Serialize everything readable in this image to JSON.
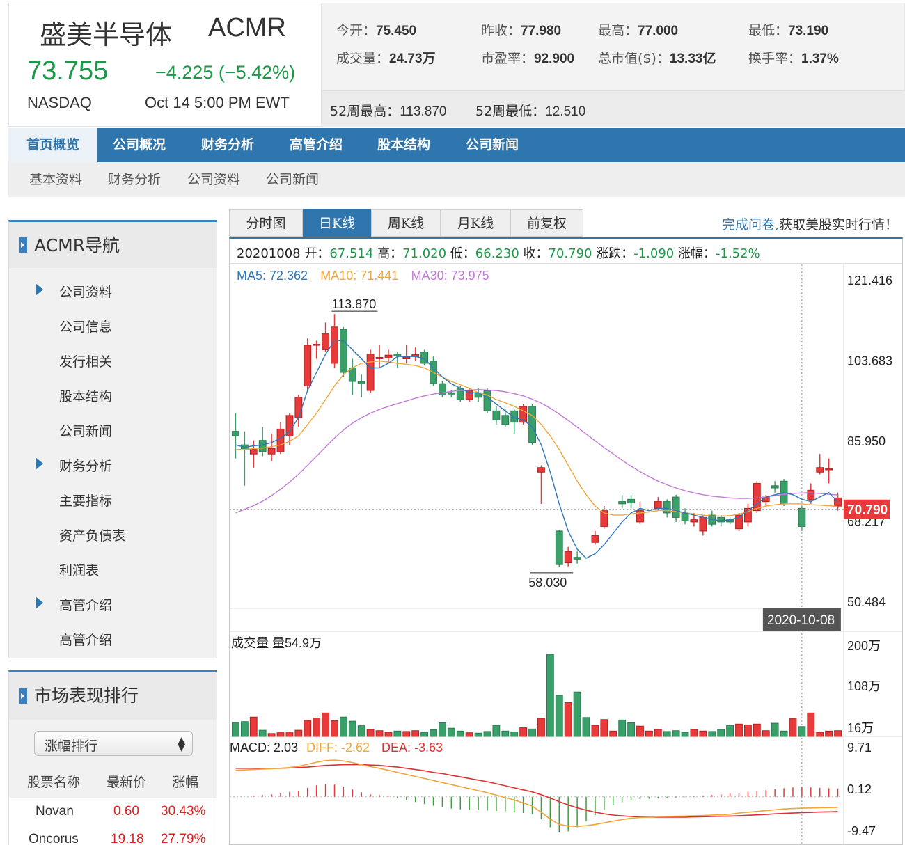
{
  "quote": {
    "name": "盛美半导体",
    "ticker": "ACMR",
    "price": "73.755",
    "change": "−4.225 (−5.42%)",
    "exchange": "NASDAQ",
    "time": "Oct 14 5:00 PM EWT",
    "stats_row1": [
      {
        "label": "今开：",
        "value": "75.450"
      },
      {
        "label": "昨收：",
        "value": "77.980"
      },
      {
        "label": "最高：",
        "value": "77.000"
      },
      {
        "label": "最低：",
        "value": "73.190"
      }
    ],
    "stats_row2": [
      {
        "label": "成交量：",
        "value": "24.73万"
      },
      {
        "label": "市盈率：",
        "value": "92.900"
      },
      {
        "label": "总市值($)：",
        "value": "13.33亿"
      },
      {
        "label": "换手率：",
        "value": "1.37%"
      }
    ],
    "week52_high_label": "52周最高：",
    "week52_high": "113.870",
    "week52_low_label": "52周最低：",
    "week52_low": "12.510",
    "down_color": "#1a9a47"
  },
  "nav": {
    "tabs": [
      "首页概览",
      "公司概况",
      "财务分析",
      "高管介绍",
      "股本结构",
      "公司新闻"
    ],
    "subtabs": [
      "基本资料",
      "财务分析",
      "公司资料",
      "公司新闻"
    ]
  },
  "sidebar": {
    "title": "ACMR导航",
    "items": [
      {
        "label": "公司资料",
        "section": true
      },
      {
        "label": "公司信息",
        "section": false
      },
      {
        "label": "发行相关",
        "section": false
      },
      {
        "label": "股本结构",
        "section": false
      },
      {
        "label": "公司新闻",
        "section": false
      },
      {
        "label": "财务分析",
        "section": true
      },
      {
        "label": "主要指标",
        "section": false
      },
      {
        "label": "资产负债表",
        "section": false
      },
      {
        "label": "利润表",
        "section": false
      },
      {
        "label": "高管介绍",
        "section": true
      },
      {
        "label": "高管介绍",
        "section": false
      }
    ]
  },
  "ranking": {
    "title": "市场表现排行",
    "select_value": "涨幅排行",
    "headers": [
      "股票名称",
      "最新价",
      "涨幅"
    ],
    "rows": [
      {
        "name": "Novan",
        "price": "0.60",
        "change": "30.43%"
      },
      {
        "name": "Oncorus",
        "price": "19.18",
        "change": "27.79%"
      }
    ]
  },
  "chart_tabs": {
    "tabs": [
      "分时图",
      "日K线",
      "周K线",
      "月K线",
      "前复权"
    ],
    "active": "日K线",
    "promo_link": "完成问卷,",
    "promo_text": "获取美股实时行情！"
  },
  "chart_info": {
    "date": "20201008",
    "fields": [
      {
        "label": " 开：",
        "value": "67.514"
      },
      {
        "label": " 高：",
        "value": "71.020"
      },
      {
        "label": " 低：",
        "value": "66.230"
      },
      {
        "label": " 收：",
        "value": "70.790"
      },
      {
        "label": " 涨跌：",
        "value": "-1.090"
      },
      {
        "label": " 涨幅：",
        "value": "-1.52%"
      }
    ],
    "ma": [
      {
        "label": "MA5: 72.362",
        "color": "#2f77b8"
      },
      {
        "label": "MA10: 71.441",
        "color": "#f0a63a"
      },
      {
        "label": "MA30: 73.975",
        "color": "#c27ad6"
      }
    ]
  },
  "chart_data": {
    "type": "candlestick",
    "title": "",
    "y_ticks": [
      "121.416",
      "103.683",
      "85.950",
      "68.217",
      "50.484"
    ],
    "ylim": [
      50.484,
      121.416
    ],
    "current_price": "70.790",
    "max_label": "113.870",
    "min_label": "58.030",
    "crosshair_date": "2020-10-08",
    "up_color": "#e83a3a",
    "down_color": "#3aa06a",
    "candles": [
      {
        "o": 88.0,
        "h": 92.0,
        "l": 82.0,
        "c": 87.0
      },
      {
        "o": 85.0,
        "h": 88.0,
        "l": 76.0,
        "c": 84.0
      },
      {
        "o": 83.0,
        "h": 86.0,
        "l": 80.0,
        "c": 84.0
      },
      {
        "o": 86.0,
        "h": 89.0,
        "l": 82.5,
        "c": 83.5
      },
      {
        "o": 83.0,
        "h": 87.5,
        "l": 81.5,
        "c": 84.2
      },
      {
        "o": 83.5,
        "h": 90.0,
        "l": 83.0,
        "c": 88.5
      },
      {
        "o": 87.0,
        "h": 92.0,
        "l": 85.0,
        "c": 91.5
      },
      {
        "o": 91.0,
        "h": 96.0,
        "l": 89.0,
        "c": 95.5
      },
      {
        "o": 98.0,
        "h": 108.5,
        "l": 97.0,
        "c": 107.0
      },
      {
        "o": 107.0,
        "h": 108.0,
        "l": 104.0,
        "c": 107.2
      },
      {
        "o": 106.0,
        "h": 112.0,
        "l": 105.5,
        "c": 109.5
      },
      {
        "o": 103.0,
        "h": 113.87,
        "l": 102.0,
        "c": 111.0
      },
      {
        "o": 110.5,
        "h": 111.0,
        "l": 100.0,
        "c": 101.0
      },
      {
        "o": 102.0,
        "h": 104.0,
        "l": 96.0,
        "c": 99.0
      },
      {
        "o": 99.0,
        "h": 100.5,
        "l": 95.5,
        "c": 98.5
      },
      {
        "o": 97.0,
        "h": 106.0,
        "l": 96.5,
        "c": 105.0
      },
      {
        "o": 104.0,
        "h": 107.0,
        "l": 102.0,
        "c": 104.3
      },
      {
        "o": 104.2,
        "h": 106.0,
        "l": 103.0,
        "c": 104.8
      },
      {
        "o": 105.0,
        "h": 105.5,
        "l": 102.0,
        "c": 104.6
      },
      {
        "o": 104.0,
        "h": 107.0,
        "l": 103.0,
        "c": 104.4
      },
      {
        "o": 104.5,
        "h": 106.5,
        "l": 103.5,
        "c": 104.9
      },
      {
        "o": 105.5,
        "h": 106.0,
        "l": 102.5,
        "c": 103.0
      },
      {
        "o": 103.5,
        "h": 104.5,
        "l": 98.0,
        "c": 98.5
      },
      {
        "o": 98.5,
        "h": 99.0,
        "l": 95.5,
        "c": 96.0
      },
      {
        "o": 96.5,
        "h": 97.0,
        "l": 95.5,
        "c": 96.2
      },
      {
        "o": 97.5,
        "h": 98.0,
        "l": 94.5,
        "c": 95.0
      },
      {
        "o": 95.0,
        "h": 97.5,
        "l": 94.5,
        "c": 97.0
      },
      {
        "o": 96.5,
        "h": 97.5,
        "l": 94.5,
        "c": 95.5
      },
      {
        "o": 97.0,
        "h": 97.5,
        "l": 92.0,
        "c": 92.5
      },
      {
        "o": 92.5,
        "h": 93.5,
        "l": 89.5,
        "c": 90.5
      },
      {
        "o": 91.5,
        "h": 93.0,
        "l": 89.0,
        "c": 89.5
      },
      {
        "o": 92.5,
        "h": 93.0,
        "l": 87.5,
        "c": 90.0
      },
      {
        "o": 90.0,
        "h": 94.0,
        "l": 89.5,
        "c": 93.5
      },
      {
        "o": 93.5,
        "h": 94.0,
        "l": 85.0,
        "c": 85.5
      },
      {
        "o": 79.0,
        "h": 80.5,
        "l": 72.0,
        "c": 80.0
      },
      {
        "o": 1,
        "h": 1,
        "l": 1,
        "c": 1,
        "skip": true
      },
      {
        "o": 66.0,
        "h": 66.2,
        "l": 58.03,
        "c": 58.6
      },
      {
        "o": 59.0,
        "h": 62.5,
        "l": 58.2,
        "c": 61.5
      },
      {
        "o": 60.2,
        "h": 61.5,
        "l": 58.8,
        "c": 59.8
      },
      {
        "o": 1,
        "h": 1,
        "l": 1,
        "c": 1,
        "skip": true
      },
      {
        "o": 63.5,
        "h": 66.0,
        "l": 63.0,
        "c": 65.0
      },
      {
        "o": 67.0,
        "h": 71.5,
        "l": 66.5,
        "c": 70.5
      },
      {
        "o": 1,
        "h": 1,
        "l": 1,
        "c": 1,
        "skip": true
      },
      {
        "o": 72.5,
        "h": 74.0,
        "l": 71.0,
        "c": 72.0
      },
      {
        "o": 73.0,
        "h": 74.0,
        "l": 71.0,
        "c": 72.2
      },
      {
        "o": 68.0,
        "h": 72.5,
        "l": 67.5,
        "c": 70.5
      },
      {
        "o": 1,
        "h": 1,
        "l": 1,
        "c": 1,
        "skip": true
      },
      {
        "o": 71.0,
        "h": 73.5,
        "l": 70.5,
        "c": 72.5
      },
      {
        "o": 72.5,
        "h": 73.0,
        "l": 69.0,
        "c": 70.0
      },
      {
        "o": 73.5,
        "h": 74.0,
        "l": 68.0,
        "c": 69.0
      },
      {
        "o": 70.0,
        "h": 71.0,
        "l": 67.5,
        "c": 68.2
      },
      {
        "o": 68.0,
        "h": 70.0,
        "l": 67.0,
        "c": 68.5
      },
      {
        "o": 66.0,
        "h": 69.5,
        "l": 65.0,
        "c": 69.0
      },
      {
        "o": 69.5,
        "h": 70.5,
        "l": 67.0,
        "c": 67.5
      },
      {
        "o": 69.0,
        "h": 69.5,
        "l": 67.0,
        "c": 68.0
      },
      {
        "o": 68.5,
        "h": 69.0,
        "l": 67.5,
        "c": 68.0
      },
      {
        "o": 66.5,
        "h": 70.0,
        "l": 66.0,
        "c": 69.5
      },
      {
        "o": 68.0,
        "h": 72.0,
        "l": 67.0,
        "c": 71.0
      },
      {
        "o": 70.5,
        "h": 77.0,
        "l": 70.0,
        "c": 76.5
      },
      {
        "o": 72.5,
        "h": 74.0,
        "l": 71.5,
        "c": 73.5
      },
      {
        "o": 76.0,
        "h": 77.0,
        "l": 74.5,
        "c": 75.5
      },
      {
        "o": 77.0,
        "h": 77.5,
        "l": 71.5,
        "c": 72.0
      },
      {
        "o": 1,
        "h": 1,
        "l": 1,
        "c": 1,
        "skip": true
      },
      {
        "o": 71.0,
        "h": 71.5,
        "l": 66.0,
        "c": 67.0
      },
      {
        "o": 73.0,
        "h": 76.5,
        "l": 72.0,
        "c": 75.0
      },
      {
        "o": 79.0,
        "h": 83.0,
        "l": 78.5,
        "c": 80.0
      },
      {
        "o": 79.5,
        "h": 82.0,
        "l": 76.5,
        "c": 79.8
      },
      {
        "o": 71.5,
        "h": 74.5,
        "l": 70.5,
        "c": 73.3
      }
    ],
    "ma5": [
      85,
      84.5,
      84.8,
      85,
      85.5,
      86.5,
      88,
      91,
      97,
      101,
      105,
      108,
      108,
      106,
      104,
      102,
      102,
      103,
      104.5,
      104.5,
      104.5,
      104,
      102,
      100,
      98.5,
      97.5,
      96.5,
      96.5,
      95.5,
      94,
      92.5,
      91,
      90.5,
      89,
      85,
      79,
      72,
      66,
      62,
      60,
      61,
      63,
      65.5,
      68,
      70,
      71,
      70.5,
      71,
      71,
      70.5,
      70,
      69.5,
      69,
      68.5,
      68.3,
      68.5,
      69,
      70.5,
      72,
      73.5,
      74,
      74.5,
      74,
      73,
      72.5,
      73.5,
      74.5,
      72.4
    ],
    "ma10": [
      84,
      84,
      84.2,
      84.3,
      84.6,
      85,
      85.8,
      87,
      89.5,
      92,
      95,
      98,
      100.5,
      102,
      103,
      103.3,
      103.5,
      103.3,
      103,
      102.8,
      102.5,
      102,
      101,
      100,
      99,
      98.3,
      97.5,
      96.5,
      96,
      95,
      94.3,
      93.5,
      92.5,
      91.5,
      89.5,
      87,
      84,
      80.5,
      77,
      74,
      71.5,
      70,
      69.5,
      69.5,
      69.8,
      70,
      70.2,
      70.5,
      70.5,
      70.3,
      70,
      69.8,
      69.5,
      69.3,
      69.3,
      69.4,
      69.7,
      70.3,
      71,
      71.5,
      71.8,
      72,
      72,
      72,
      71.8,
      71.7,
      71.6,
      71.4
    ],
    "ma30": [
      70,
      70.8,
      71.6,
      72.6,
      73.8,
      75.2,
      76.8,
      78.5,
      80.5,
      82.5,
      84.5,
      86.5,
      88.3,
      89.8,
      91,
      92,
      92.8,
      93.5,
      94.1,
      94.7,
      95.3,
      95.8,
      96.2,
      96.5,
      96.8,
      97,
      97.1,
      97.2,
      97.1,
      97,
      96.7,
      96.3,
      95.8,
      95.1,
      94.2,
      93.1,
      91.8,
      90.4,
      88.9,
      87.4,
      85.9,
      84.4,
      83,
      81.6,
      80.3,
      79.1,
      78,
      77,
      76.2,
      75.5,
      74.9,
      74.4,
      74,
      73.7,
      73.5,
      73.3,
      73.2,
      73.2,
      73.3,
      73.5,
      73.8,
      74.1,
      74.3,
      74.4,
      74.4,
      74.3,
      74.1,
      73.98
    ],
    "volume": {
      "label": "成交量 量54.9万",
      "y_ticks": [
        "200万",
        "108万",
        "16万"
      ],
      "values": [
        34,
        36,
        47,
        15,
        7,
        9,
        11,
        15,
        39,
        45,
        57,
        38,
        47,
        37,
        26,
        17,
        14,
        10,
        13,
        12,
        14,
        10,
        16,
        33,
        20,
        13,
        9,
        8,
        12,
        27,
        13,
        11,
        21,
        18,
        44,
        200,
        100,
        82,
        108,
        46,
        27,
        41,
        13,
        40,
        33,
        25,
        13,
        17,
        12,
        14,
        10,
        17,
        13,
        12,
        17,
        27,
        30,
        28,
        30,
        14,
        32,
        13,
        43,
        24,
        57,
        10,
        13,
        14
      ],
      "ylim": [
        0,
        210
      ]
    },
    "macd": {
      "label": "MACD: 2.03",
      "diff_label": "DIFF: -2.62",
      "dea_label": "DEA: -3.63",
      "y_ticks": [
        "9.71",
        "0.12",
        "-9.47"
      ],
      "ylim": [
        -9.47,
        9.71
      ],
      "hist": [
        0,
        0,
        0.2,
        0.4,
        0.6,
        0.8,
        1.2,
        1.5,
        2.2,
        2.8,
        3.1,
        3.0,
        2.5,
        1.8,
        1.1,
        0.6,
        0.4,
        0.1,
        -0.4,
        -0.8,
        -1.3,
        -1.8,
        -2.2,
        -2.6,
        -2.9,
        -3.1,
        -3.2,
        -3.3,
        -3.4,
        -3.5,
        -3.6,
        -3.8,
        -4.0,
        -4.3,
        -5.5,
        -7.5,
        -8.8,
        -8.5,
        -7.5,
        -6.0,
        -4.5,
        -3.2,
        -2.1,
        -1.3,
        -0.8,
        -0.6,
        -0.5,
        -0.4,
        -0.3,
        -0.2,
        -0.1,
        0.1,
        0.2,
        0.4,
        0.6,
        0.8,
        1.0,
        1.2,
        1.4,
        1.6,
        1.9,
        2.1,
        2.3,
        2.4,
        2.3,
        2.2,
        2.1,
        2.03
      ],
      "diff": [
        6.5,
        6.6,
        6.7,
        6.8,
        6.9,
        7.0,
        7.2,
        7.5,
        8.0,
        8.5,
        8.9,
        9.0,
        8.8,
        8.4,
        7.9,
        7.4,
        7.0,
        6.5,
        6.0,
        5.5,
        5.0,
        4.5,
        4.0,
        3.5,
        3.0,
        2.5,
        2.0,
        1.5,
        1.0,
        0.4,
        -0.2,
        -0.8,
        -1.5,
        -2.3,
        -3.8,
        -5.5,
        -6.8,
        -7.2,
        -7.3,
        -7.1,
        -6.8,
        -6.4,
        -6.0,
        -5.6,
        -5.3,
        -5.1,
        -5.0,
        -4.9,
        -4.85,
        -4.8,
        -4.75,
        -4.7,
        -4.6,
        -4.5,
        -4.4,
        -4.3,
        -4.0,
        -3.8,
        -3.6,
        -3.4,
        -3.2,
        -3.0,
        -2.9,
        -2.8,
        -2.75,
        -2.7,
        -2.65,
        -2.62
      ],
      "dea": [
        7.0,
        7.0,
        7.0,
        7.0,
        7.0,
        7.0,
        7.1,
        7.2,
        7.3,
        7.5,
        7.7,
        7.8,
        7.9,
        7.9,
        7.9,
        7.8,
        7.7,
        7.5,
        7.3,
        7.0,
        6.7,
        6.4,
        6.0,
        5.7,
        5.3,
        4.9,
        4.5,
        4.1,
        3.7,
        3.2,
        2.7,
        2.2,
        1.7,
        1.2,
        0.5,
        -0.3,
        -1.2,
        -2.0,
        -2.7,
        -3.3,
        -3.8,
        -4.2,
        -4.5,
        -4.7,
        -4.85,
        -4.95,
        -5.0,
        -5.0,
        -5.0,
        -5.0,
        -5.0,
        -4.95,
        -4.9,
        -4.85,
        -4.8,
        -4.75,
        -4.65,
        -4.55,
        -4.45,
        -4.35,
        -4.2,
        -4.1,
        -4.0,
        -3.9,
        -3.85,
        -3.75,
        -3.7,
        -3.63
      ]
    }
  }
}
